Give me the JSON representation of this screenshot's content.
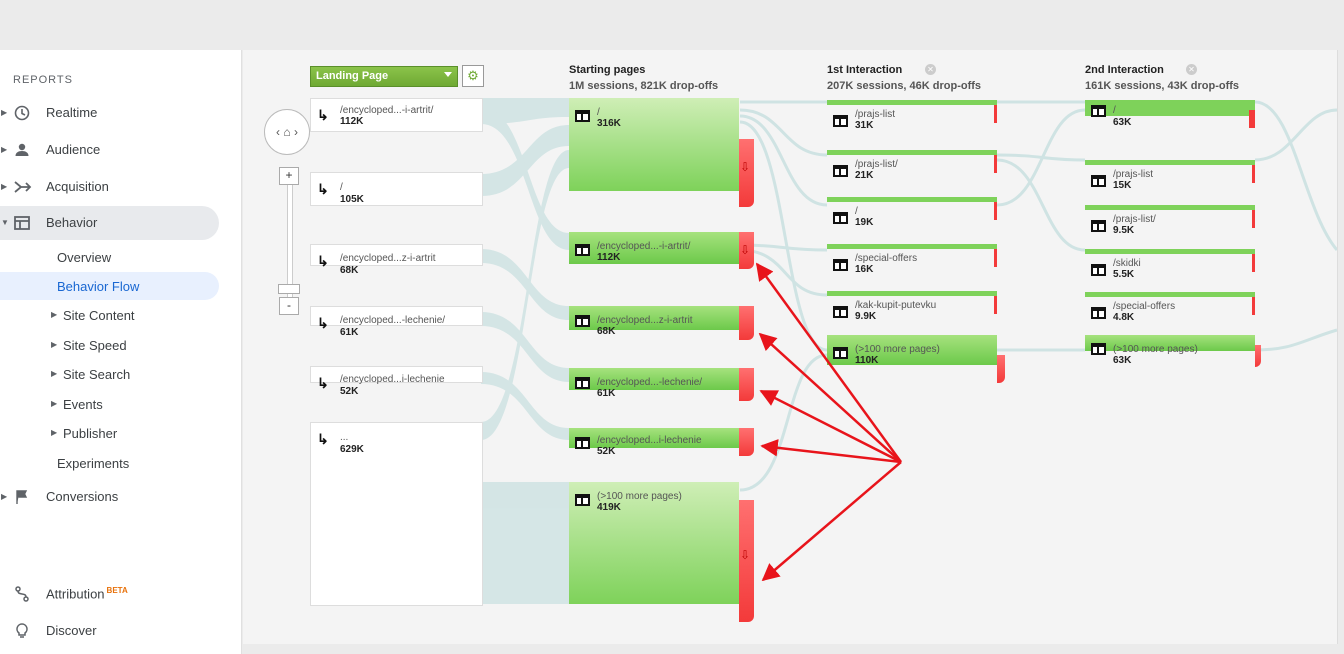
{
  "sidebar": {
    "section": "REPORTS",
    "items": [
      {
        "label": "Realtime",
        "icon": "clock-icon"
      },
      {
        "label": "Audience",
        "icon": "person-icon"
      },
      {
        "label": "Acquisition",
        "icon": "acquisition-icon"
      },
      {
        "label": "Behavior",
        "icon": "behavior-icon"
      }
    ],
    "behavior_sub": [
      {
        "label": "Overview",
        "expandable": false
      },
      {
        "label": "Behavior Flow",
        "expandable": false,
        "selected": true
      },
      {
        "label": "Site Content",
        "expandable": true
      },
      {
        "label": "Site Speed",
        "expandable": true
      },
      {
        "label": "Site Search",
        "expandable": true
      },
      {
        "label": "Events",
        "expandable": true
      },
      {
        "label": "Publisher",
        "expandable": true
      },
      {
        "label": "Experiments",
        "expandable": false
      }
    ],
    "conversions": "Conversions",
    "attribution": "Attribution",
    "beta": "BETA",
    "discover": "Discover"
  },
  "flow": {
    "dimension_select": "Landing Page",
    "zoom_in": "+",
    "zoom_out": "-",
    "starting": {
      "title": "Starting pages",
      "subtitle": "1M sessions, 821K drop-offs"
    },
    "interaction1": {
      "title": "1st Interaction",
      "subtitle": "207K sessions, 46K drop-offs"
    },
    "interaction2": {
      "title": "2nd Interaction",
      "subtitle": "161K sessions, 43K drop-offs"
    },
    "landing_nodes": [
      {
        "name": "/encycloped...-i-artrit/",
        "value": "112K"
      },
      {
        "name": "/",
        "value": "105K"
      },
      {
        "name": "/encycloped...z-i-artrit",
        "value": "68K"
      },
      {
        "name": "/encycloped...-lechenie/",
        "value": "61K"
      },
      {
        "name": "/encycloped...i-lechenie",
        "value": "52K"
      },
      {
        "name": "...",
        "value": "629K"
      }
    ],
    "starting_nodes": [
      {
        "name": "/",
        "value": "316K"
      },
      {
        "name": "/encycloped...-i-artrit/",
        "value": "112K"
      },
      {
        "name": "/encycloped...z-i-artrit",
        "value": "68K"
      },
      {
        "name": "/encycloped...-lechenie/",
        "value": "61K"
      },
      {
        "name": "/encycloped...i-lechenie",
        "value": "52K"
      },
      {
        "name": "(>100 more pages)",
        "value": "419K"
      }
    ],
    "interaction1_nodes": [
      {
        "name": "/prajs-list",
        "value": "31K"
      },
      {
        "name": "/prajs-list/",
        "value": "21K"
      },
      {
        "name": "/",
        "value": "19K"
      },
      {
        "name": "/special-offers",
        "value": "16K"
      },
      {
        "name": "/kak-kupit-putevku",
        "value": "9.9K"
      },
      {
        "name": "(>100 more pages)",
        "value": "110K"
      }
    ],
    "interaction2_nodes": [
      {
        "name": "/",
        "value": "63K"
      },
      {
        "name": "/prajs-list",
        "value": "15K"
      },
      {
        "name": "/prajs-list/",
        "value": "9.5K"
      },
      {
        "name": "/skidki",
        "value": "5.5K"
      },
      {
        "name": "/special-offers",
        "value": "4.8K"
      },
      {
        "name": "(>100 more pages)",
        "value": "63K"
      }
    ]
  },
  "colors": {
    "node_green": "#7ed25a",
    "drop_red": "#f33a3a",
    "annotation_arrow": "#e8141b",
    "link": "#cfe3e3"
  }
}
